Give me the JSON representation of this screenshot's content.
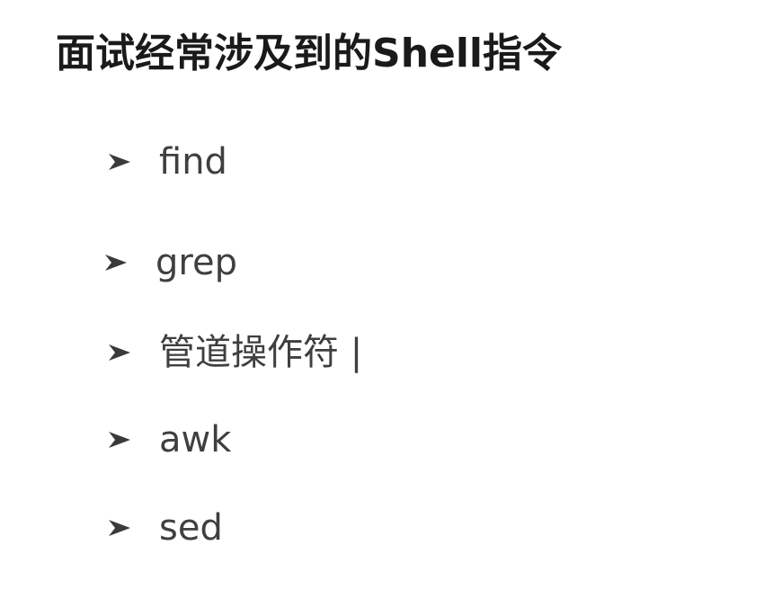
{
  "slide": {
    "title": "面试经常涉及到的Shell指令",
    "items": [
      {
        "icon": "arrowhead-bullet-icon",
        "text": "find"
      },
      {
        "icon": "arrowhead-bullet-icon",
        "text": "grep"
      },
      {
        "icon": "arrowhead-bullet-icon",
        "text": "管道操作符 |"
      },
      {
        "icon": "arrowhead-bullet-icon",
        "text": "awk"
      },
      {
        "icon": "arrowhead-bullet-icon",
        "text": "sed"
      }
    ]
  }
}
